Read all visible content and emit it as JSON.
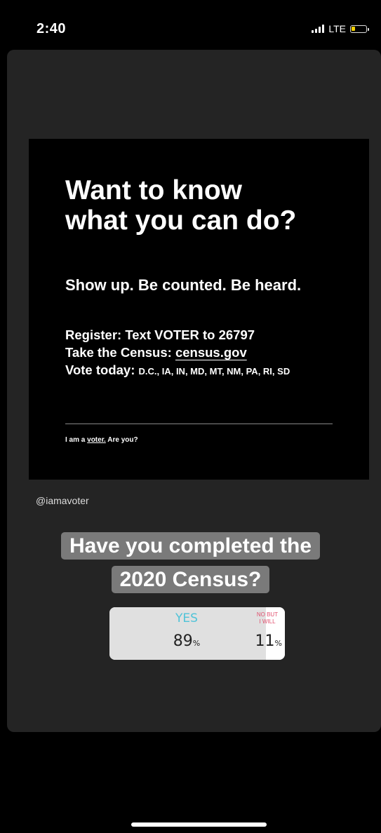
{
  "status_bar": {
    "time": "2:40",
    "network": "LTE",
    "signal_bars": 4,
    "battery_level": 0.2
  },
  "post": {
    "headline_line1": "Want to know",
    "headline_line2": "what you can do?",
    "tagline": "Show up. Be counted. Be heard.",
    "register_text": "Register: Text VOTER to 26797",
    "census_prefix": "Take the Census: ",
    "census_link": "census.gov",
    "vote_prefix": "Vote today: ",
    "vote_states": "D.C., IA, IN, MD, MT, NM, PA, RI, SD",
    "footer_prefix": "I am a ",
    "footer_voter": "voter.",
    "footer_suffix": " Are you?"
  },
  "handle": "@iamavoter",
  "question": {
    "line1": "Have you completed the",
    "line2": "2020 Census?"
  },
  "poll": {
    "yes_label": "YES",
    "yes_percent": "89",
    "no_label_line1": "NO BUT",
    "no_label_line2": "I WILL",
    "no_percent": "11",
    "percent_sign": "%",
    "yes_color": "#4fc3d8",
    "no_color": "#e0506e"
  }
}
